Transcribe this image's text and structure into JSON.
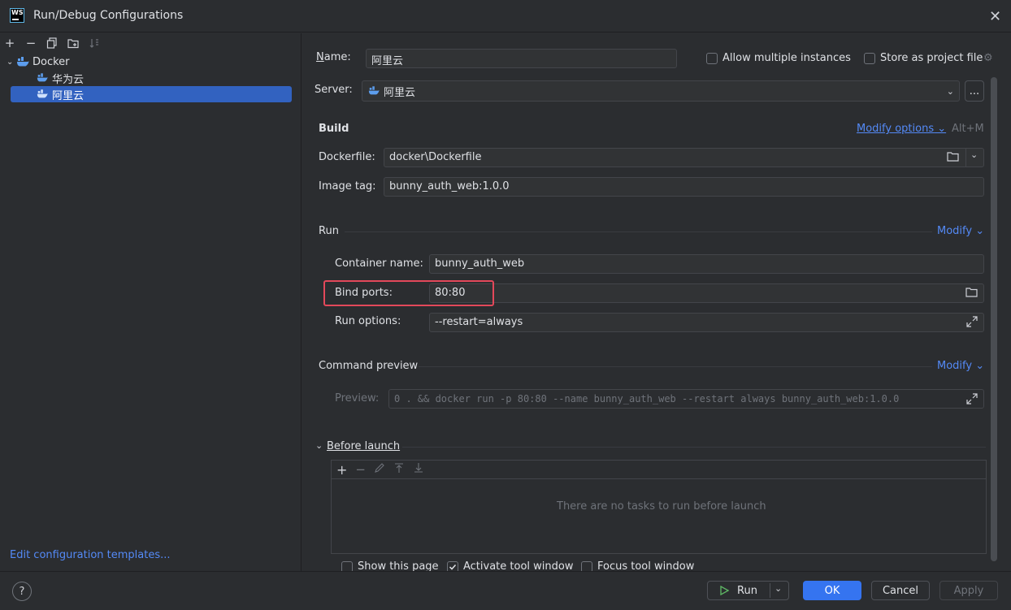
{
  "window": {
    "title": "Run/Debug Configurations",
    "app_icon_text": "WS"
  },
  "tree": {
    "root": "Docker",
    "items": [
      "华为云",
      "阿里云"
    ],
    "selected": "阿里云"
  },
  "left": {
    "edit_templates": "Edit configuration templates..."
  },
  "form": {
    "name_label": "Name:",
    "name_value": "阿里云",
    "allow_multiple": "Allow multiple instances",
    "store_as_project": "Store as project file",
    "server_label": "Server:",
    "server_value": "阿里云",
    "server_more": "...",
    "build_title": "Build",
    "modify_options": "Modify options",
    "modify_shortcut": "Alt+M",
    "dockerfile_label": "Dockerfile:",
    "dockerfile_value": "docker\\Dockerfile",
    "image_tag_label": "Image tag:",
    "image_tag_value": "bunny_auth_web:1.0.0",
    "run_title": "Run",
    "modify_run": "Modify",
    "container_name_label": "Container name:",
    "container_name_value": "bunny_auth_web",
    "bind_ports_label": "Bind ports:",
    "bind_ports_value": "80:80",
    "run_options_label": "Run options:",
    "run_options_value": "--restart=always",
    "command_preview_title": "Command preview",
    "modify_preview": "Modify",
    "preview_label": "Preview:",
    "preview_value": "0 . && docker run -p 80:80 --name bunny_auth_web --restart always bunny_auth_web:1.0.0",
    "before_launch_title": "Before launch",
    "no_tasks": "There are no tasks to run before launch",
    "show_this_page": "Show this page",
    "activate_tool_window": "Activate tool window",
    "focus_tool_window": "Focus tool window"
  },
  "buttons": {
    "run": "Run",
    "ok": "OK",
    "cancel": "Cancel",
    "apply": "Apply",
    "help": "?"
  },
  "colors": {
    "accent": "#3574f0",
    "link": "#548af7",
    "highlight": "#e3485a",
    "docker": "#5c9ded"
  }
}
